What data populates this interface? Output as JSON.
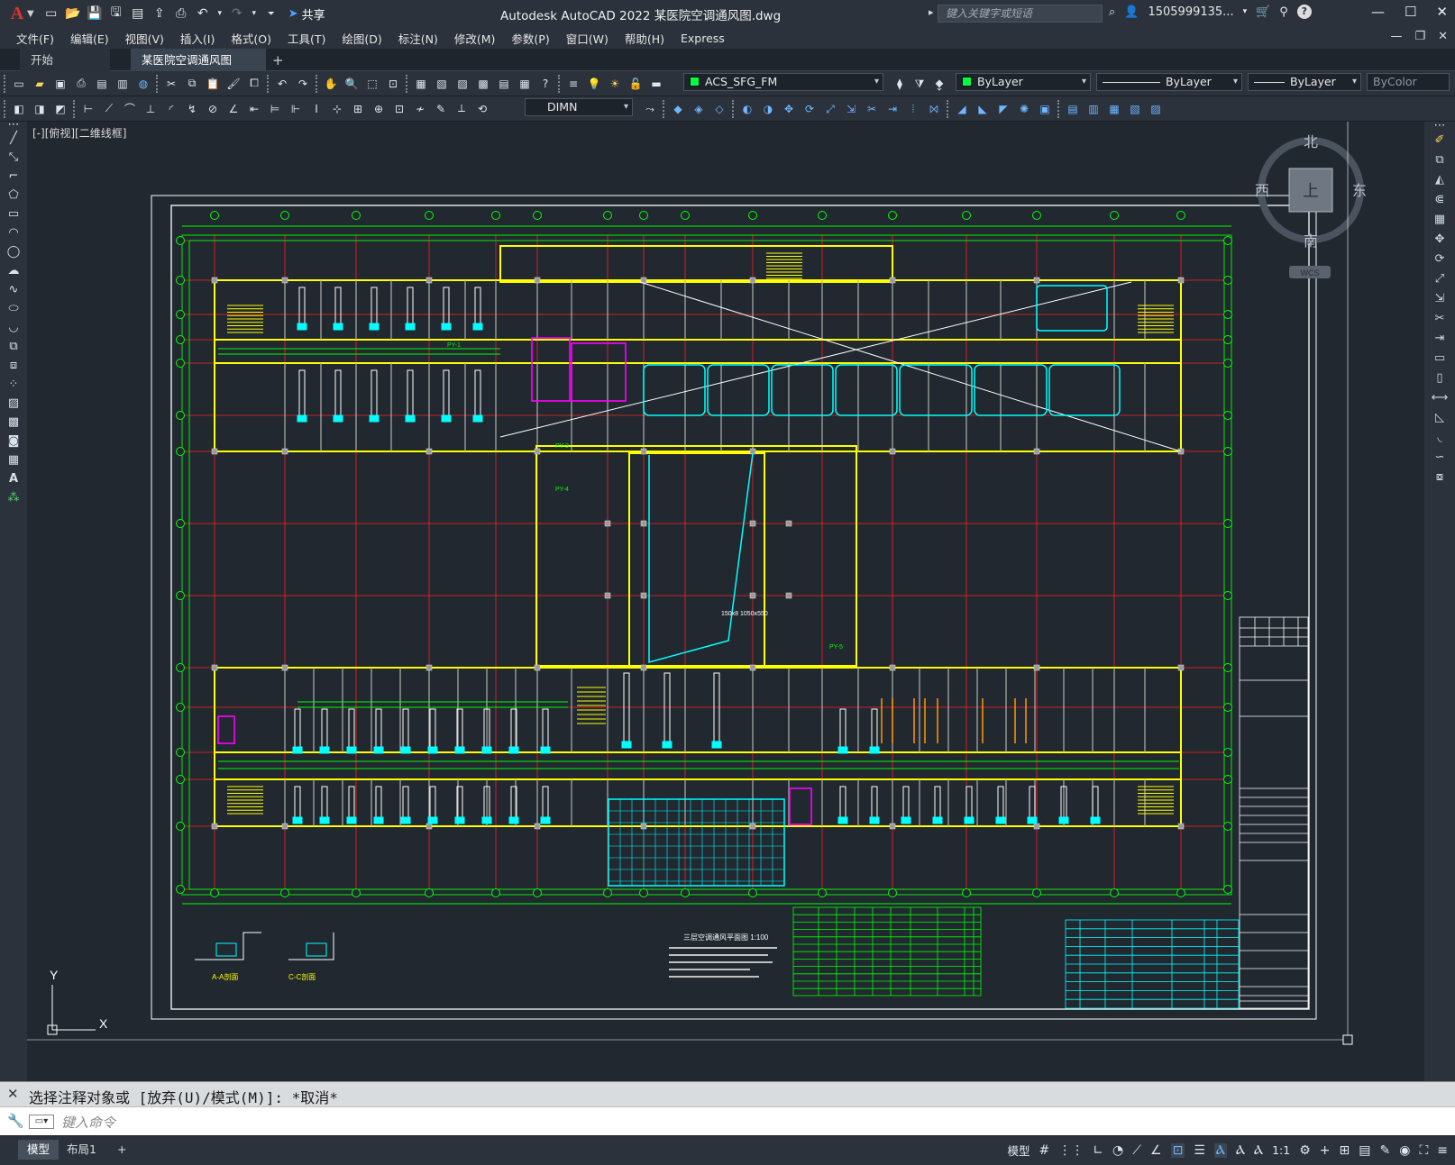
{
  "app": {
    "logo": "A",
    "window_title": "Autodesk AutoCAD 2022    某医院空调通风图.dwg",
    "share_label": "共享",
    "search_placeholder": "键入关键字或短语",
    "user_name": "1505999135...",
    "help_label": "?"
  },
  "menu": [
    "文件(F)",
    "编辑(E)",
    "视图(V)",
    "插入(I)",
    "格式(O)",
    "工具(T)",
    "绘图(D)",
    "标注(N)",
    "修改(M)",
    "参数(P)",
    "窗口(W)",
    "帮助(H)",
    "Express"
  ],
  "tabs": {
    "start": "开始",
    "active": "某医院空调通风图*"
  },
  "toolbar": {
    "layer_name": "ACS_SFG_FM",
    "color": "ByLayer",
    "linetype": "ByLayer",
    "lineweight": "ByLayer",
    "plotstyle": "ByColor",
    "dim_style": "DIMN",
    "layer_color": "#00ff40"
  },
  "viewport": {
    "label": "[-][俯视][二维线框]",
    "viewcube": {
      "north": "北",
      "south": "南",
      "east": "东",
      "west": "西",
      "top": "上",
      "wcs": "WCS"
    },
    "ucs": {
      "x": "X",
      "y": "Y"
    }
  },
  "drawing": {
    "plan_title": "三层空调通风平面图  1:100",
    "section_a": "A-A剖面",
    "section_c": "C-C剖面",
    "duct_note": "150x8  1050x550",
    "riser_labels": [
      "PY-1",
      "PY-3",
      "PY-4",
      "PY-5"
    ],
    "colors": {
      "wall": "#ffff00",
      "grid": "#ff0000",
      "axis": "#00ff00",
      "duct": "#00ffff",
      "column": "#c0c0c0",
      "equipment": "#ff00ff",
      "frame": "#ffffff",
      "pipe": "#ff9900"
    }
  },
  "command": {
    "history": "选择注释对象或 [放弃(U)/模式(M)]: *取消*",
    "placeholder": "键入命令"
  },
  "status": {
    "model_tab": "模型",
    "layout_tab": "布局1",
    "model_label": "模型",
    "scale": "1:1"
  }
}
